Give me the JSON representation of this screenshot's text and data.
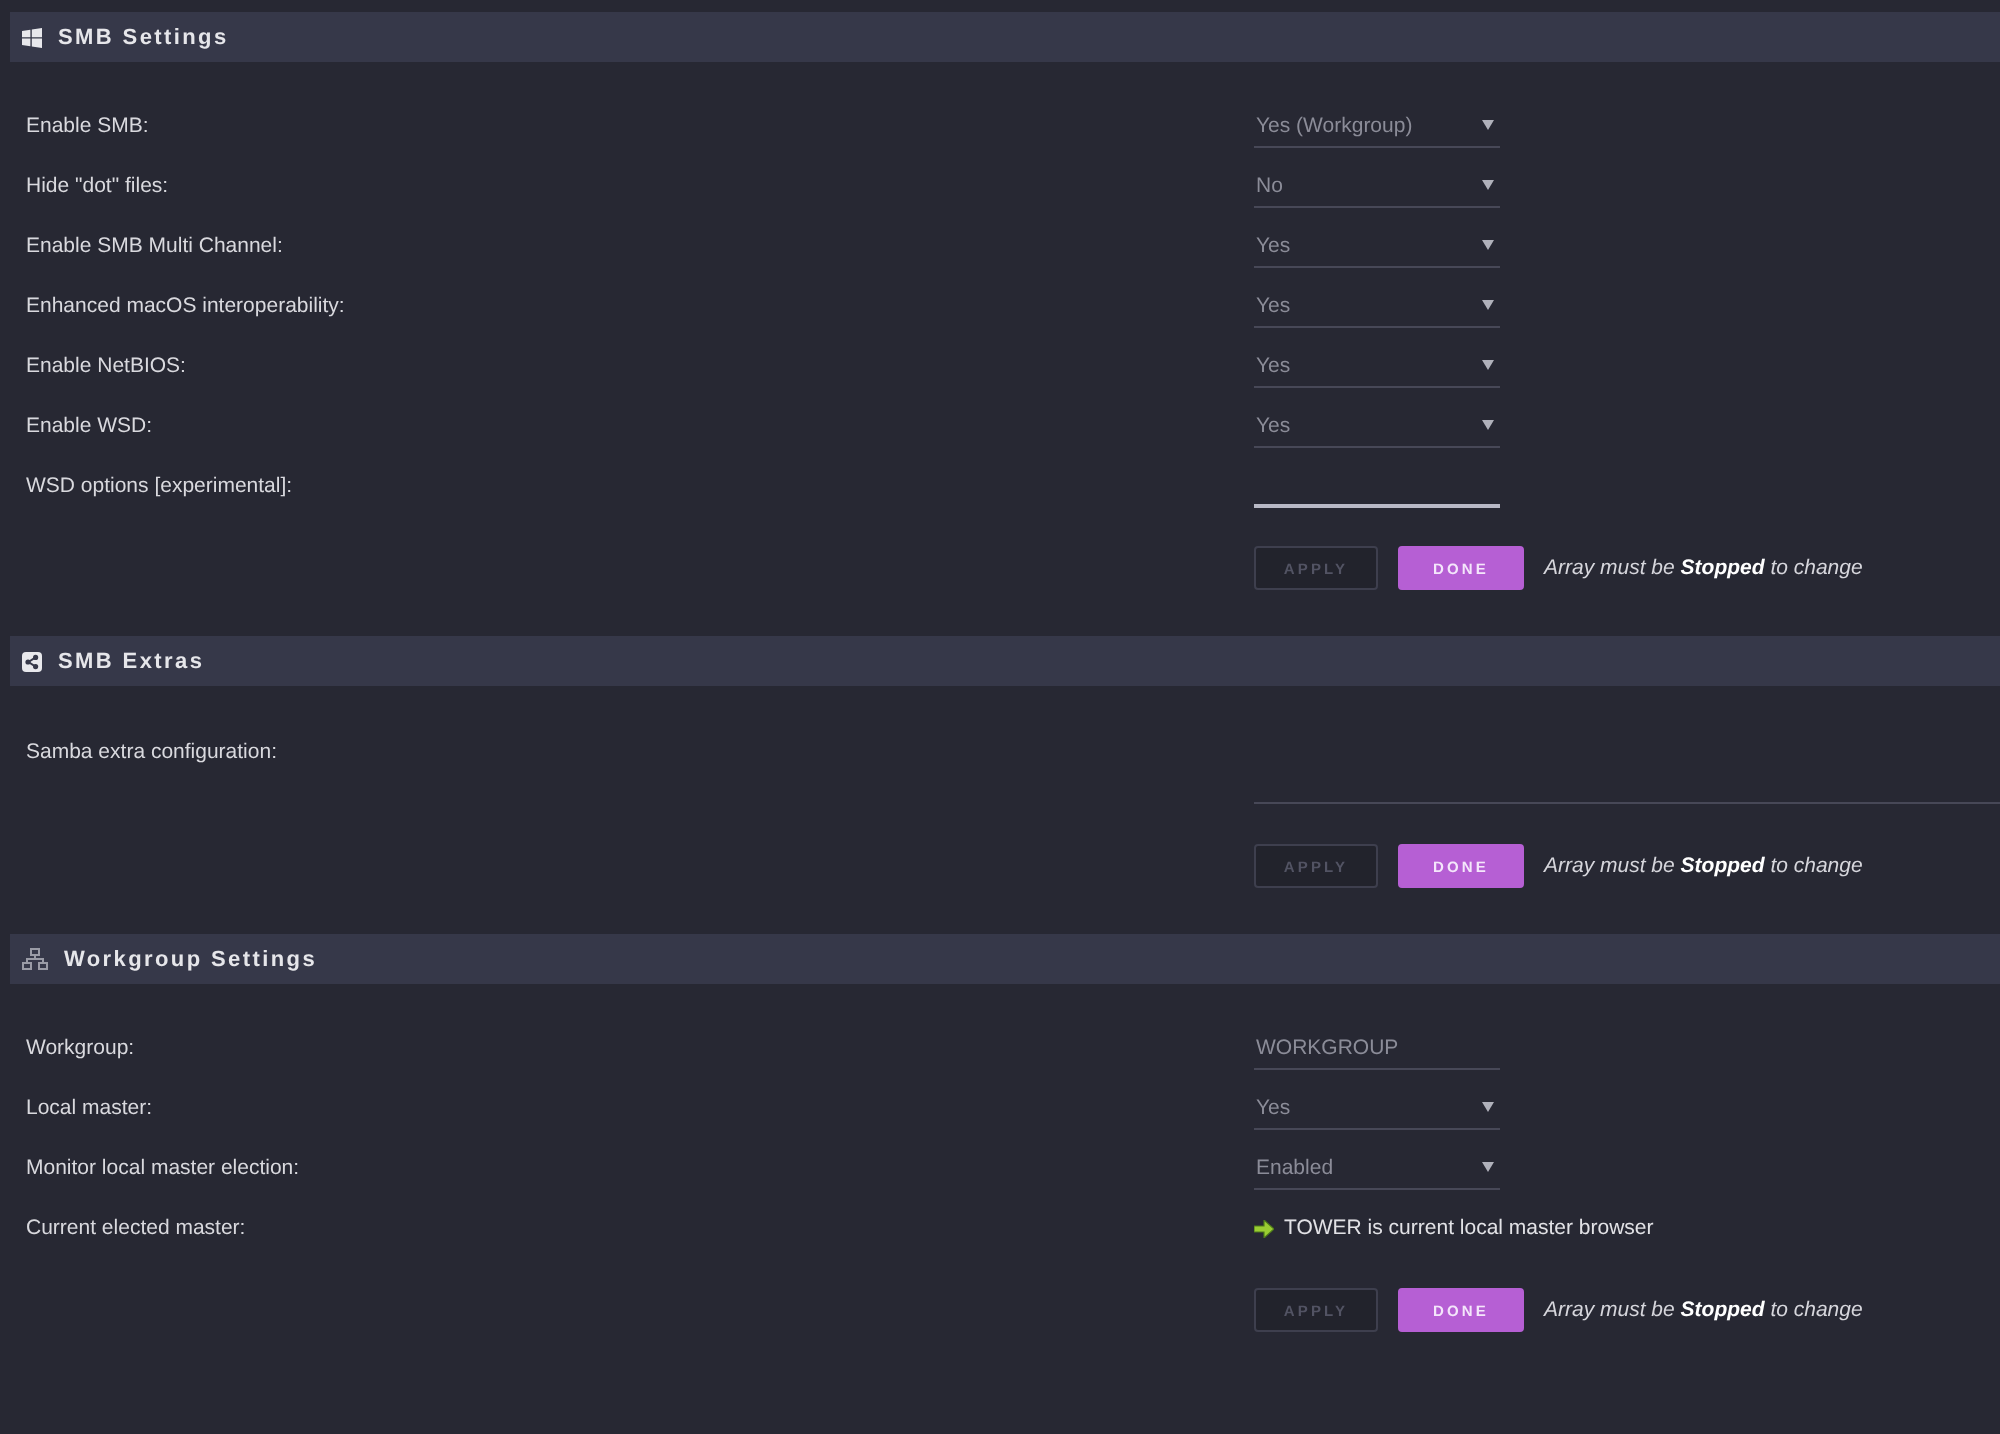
{
  "sections": [
    {
      "title": "SMB Settings",
      "rows": [
        {
          "label": "Enable SMB:",
          "kind": "select",
          "value": "Yes (Workgroup)"
        },
        {
          "label": "Hide \"dot\" files:",
          "kind": "select",
          "value": "No"
        },
        {
          "label": "Enable SMB Multi Channel:",
          "kind": "select",
          "value": "Yes"
        },
        {
          "label": "Enhanced macOS interoperability:",
          "kind": "select",
          "value": "Yes"
        },
        {
          "label": "Enable NetBIOS:",
          "kind": "select",
          "value": "Yes"
        },
        {
          "label": "Enable WSD:",
          "kind": "select",
          "value": "Yes"
        },
        {
          "label": "WSD options [experimental]:",
          "kind": "input",
          "focused": true
        }
      ],
      "buttons": [
        {
          "label": "APPLY",
          "kind": "secondary",
          "disabled": true
        },
        {
          "label": "DONE",
          "kind": "primary",
          "disabled": false
        }
      ],
      "note": "Array must be **Stopped** to change"
    },
    {
      "title": "SMB Extras",
      "rows": [
        {
          "label": "Samba extra configuration:",
          "kind": "textarea",
          "focused": false
        }
      ],
      "buttons": [
        {
          "label": "APPLY",
          "kind": "secondary",
          "disabled": true
        },
        {
          "label": "DONE",
          "kind": "primary",
          "disabled": false
        }
      ],
      "note": "Array must be **Stopped** to change"
    },
    {
      "title": "Workgroup Settings",
      "rows": [
        {
          "label": "Workgroup:",
          "kind": "input",
          "value": "WORKGROUP",
          "focused": false
        },
        {
          "label": "Local master:",
          "kind": "select",
          "value": "Yes"
        },
        {
          "label": "Monitor local master election:",
          "kind": "select",
          "value": "Enabled"
        },
        {
          "label": "Current elected master:",
          "kind": "status",
          "value": "TOWER is current local master browser"
        }
      ],
      "buttons": [
        {
          "label": "APPLY",
          "kind": "secondary",
          "disabled": true
        },
        {
          "label": "DONE",
          "kind": "primary",
          "disabled": false
        }
      ],
      "note": "Array must be **Stopped** to change"
    }
  ]
}
